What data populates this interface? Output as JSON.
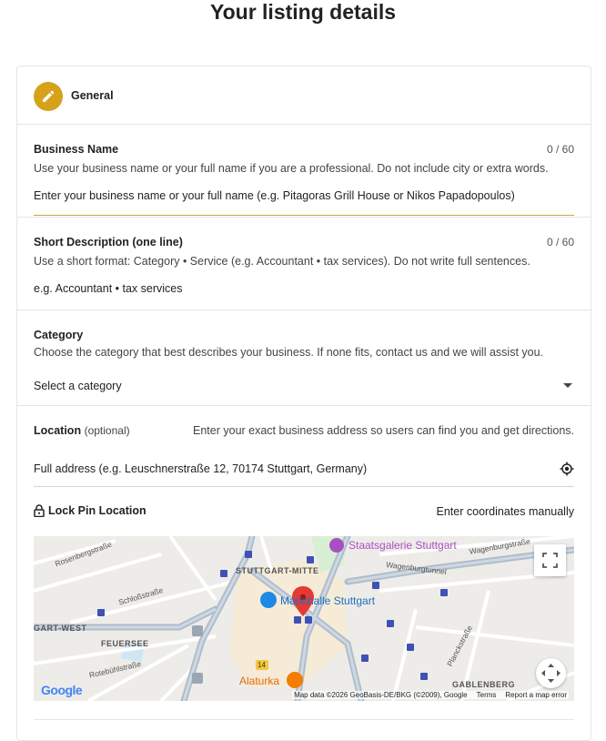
{
  "page": {
    "title": "Your listing details"
  },
  "general": {
    "label": "General",
    "icon": "pencil-icon",
    "icon_color": "#d6a21a"
  },
  "business_name": {
    "label": "Business Name",
    "counter": "0 / 60",
    "help": "Use your business name or your full name if you are a professional. Do not include city or extra words.",
    "placeholder": "Enter your business name or your full name (e.g. Pitagoras Grill House or Nikos Papadopoulos)",
    "value": ""
  },
  "short_description": {
    "label": "Short Description (one line)",
    "counter": "0 / 60",
    "help": "Use a short format: Category • Service (e.g. Accountant • tax services). Do not write full sentences.",
    "placeholder": "e.g. Accountant • tax services",
    "value": ""
  },
  "category": {
    "label": "Category",
    "help": "Choose the category that best describes your business. If none fits, contact us and we will assist you.",
    "selected": "Select a category"
  },
  "location": {
    "label": "Location",
    "optional": "(optional)",
    "help": "Enter your exact business address so users can find you and get directions.",
    "placeholder": "Full address (e.g. Leuschnerstraße 12, 70174 Stuttgart, Germany)",
    "value": "",
    "lock_pin_label": "Lock Pin Location",
    "manual_coords": "Enter coordinates manually"
  },
  "map": {
    "labels": {
      "staatsgalerie": "Staatsgalerie Stuttgart",
      "markthalle": "Markthalle Stuttgart",
      "stuttgart_mitte": "STUTTGART-MITTE",
      "gart_west": "GART-WEST",
      "feuersee": "FEUERSEE",
      "gablenberg": "GABLENBERG",
      "alaturka": "Alaturka",
      "rosenbergstrasse": "Rosenbergstraße",
      "schlossstrasse": "Schloßstraße",
      "rotebuehlstrasse": "Rotebühlstraße",
      "wagenburgtunnel": "Wagenburgtunnel",
      "wagenburgstrasse": "Wagenburgstraße",
      "planckstrasse": "Planckstraße",
      "road_14": "14"
    },
    "google": "Google",
    "attribution": "Map data ©2026 GeoBasis-DE/BKG (©2009), Google",
    "terms": "Terms",
    "report": "Report a map error",
    "pin_color": "#e53935"
  }
}
